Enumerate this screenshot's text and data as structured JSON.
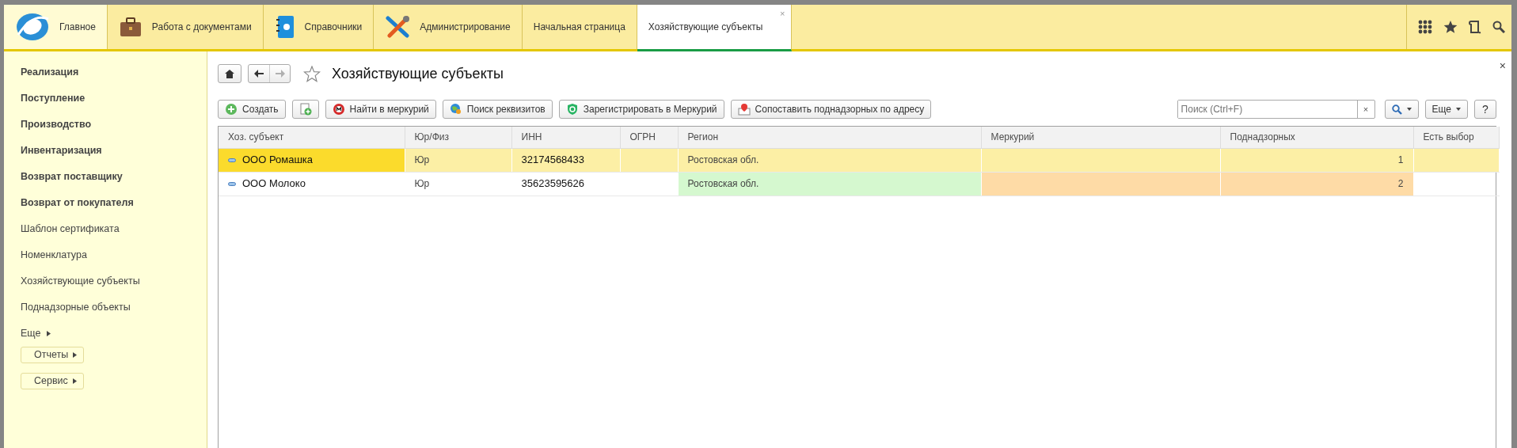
{
  "top_bar": {
    "sections": [
      {
        "label": "Главное",
        "selected": true
      },
      {
        "label": "Работа с документами",
        "selected": false
      },
      {
        "label": "Справочники",
        "selected": false
      },
      {
        "label": "Администрирование",
        "selected": false
      }
    ],
    "open_tabs": [
      {
        "label": "Начальная страница",
        "selected": false
      },
      {
        "label": "Хозяйствующие субъекты",
        "selected": true,
        "close": "×"
      }
    ]
  },
  "sidebar": {
    "items": [
      {
        "kind": "link",
        "label": "Реализация",
        "emphasized": true
      },
      {
        "kind": "link",
        "label": "Поступление",
        "emphasized": true
      },
      {
        "kind": "link",
        "label": "Производство",
        "emphasized": true
      },
      {
        "kind": "link",
        "label": "Инвентаризация",
        "emphasized": true
      },
      {
        "kind": "link",
        "label": "Возврат поставщику",
        "emphasized": true
      },
      {
        "kind": "link",
        "label": "Возврат от покупателя",
        "emphasized": true
      },
      {
        "kind": "link",
        "label": "Шаблон сертификата",
        "emphasized": false
      },
      {
        "kind": "link",
        "label": "Номенклатура",
        "emphasized": false
      },
      {
        "kind": "link",
        "label": "Хозяйствующие субъекты",
        "emphasized": false
      },
      {
        "kind": "link",
        "label": "Поднадзорные объекты",
        "emphasized": false
      },
      {
        "kind": "more",
        "label": "Еще",
        "emphasized": false
      }
    ],
    "buttons": [
      "Отчеты",
      "Сервис"
    ]
  },
  "form": {
    "title": "Хозяйствующие субъекты",
    "favorite": false,
    "close": "×",
    "back": {
      "disabled": false
    },
    "forward": {
      "disabled": true
    }
  },
  "toolbar": {
    "buttons": [
      {
        "kind": "labeled",
        "label": "Создать"
      },
      {
        "kind": "icon"
      },
      {
        "kind": "labeled",
        "label": "Найти в меркурий"
      },
      {
        "kind": "labeled",
        "label": "Поиск реквизитов"
      },
      {
        "kind": "labeled",
        "label": "Зарегистрировать в Меркурий"
      },
      {
        "kind": "labeled",
        "label": "Сопоставить поднадзорных по адресу"
      }
    ],
    "search": {
      "placeholder": "Поиск (Ctrl+F)",
      "clear": "×"
    },
    "more": "Еще",
    "help": "?"
  },
  "table": {
    "columns": [
      {
        "label": "Хоз. субъект",
        "kind": "tree"
      },
      {
        "label": "Юр/Физ",
        "kind": "text"
      },
      {
        "label": "ИНН",
        "kind": "code"
      },
      {
        "label": "ОГРН",
        "kind": "text"
      },
      {
        "label": "Регион",
        "kind": "text"
      },
      {
        "label": "Меркурий",
        "kind": "text"
      },
      {
        "label": "Поднадзорных",
        "kind": "number"
      },
      {
        "label": "Есть выбор",
        "kind": "text"
      }
    ],
    "rows": [
      {
        "selected": true,
        "cells": [
          {
            "text": "ООО Ромашка",
            "current": true
          },
          {
            "text": "Юр",
            "current": false
          },
          {
            "text": "32174568433",
            "current": false
          },
          {
            "current": false
          },
          {
            "text": "Ростовская обл.",
            "current": false
          },
          {
            "current": false
          },
          {
            "text": "1",
            "current": false
          },
          {
            "current": false
          }
        ]
      },
      {
        "selected": false,
        "cells": [
          {
            "text": "ООО Молоко",
            "current": false
          },
          {
            "text": "Юр",
            "current": false
          },
          {
            "text": "35623595626",
            "current": false
          },
          {
            "current": false
          },
          {
            "text": "Ростовская обл.",
            "current": false,
            "color": "#d5f8cf"
          },
          {
            "current": false,
            "color": "#fedba6"
          },
          {
            "text": "2",
            "current": false,
            "color": "#fedba6"
          },
          {
            "current": false
          }
        ]
      }
    ]
  }
}
